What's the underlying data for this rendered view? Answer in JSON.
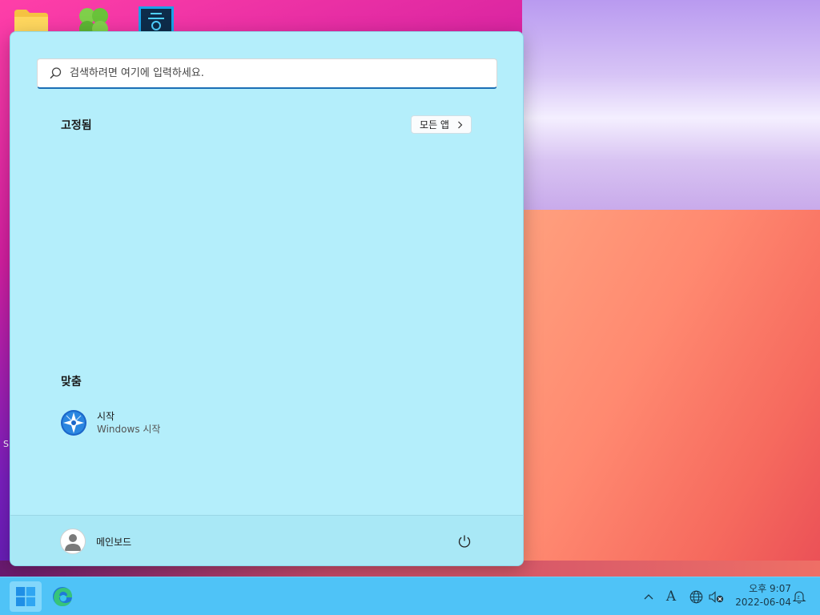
{
  "search": {
    "placeholder": "검색하려면 여기에 입력하세요."
  },
  "pinned": {
    "title": "고정됨",
    "all_apps_label": "모든 앱"
  },
  "recommended": {
    "title": "맞춤",
    "items": [
      {
        "name": "시작",
        "subtitle": "Windows 시작",
        "icon": "get-started-icon"
      }
    ]
  },
  "footer": {
    "user_name": "메인보드"
  },
  "desktop": {
    "edge_text": "S"
  },
  "taskbar": {
    "apps": [
      "start-icon",
      "edge-icon"
    ],
    "ime_label": "A",
    "time": "오후 9:07",
    "date": "2022-06-04"
  },
  "colors": {
    "menu_bg": "#b4eefb",
    "taskbar_bg": "#4fc3f7",
    "search_accent": "#1b6fb5"
  }
}
